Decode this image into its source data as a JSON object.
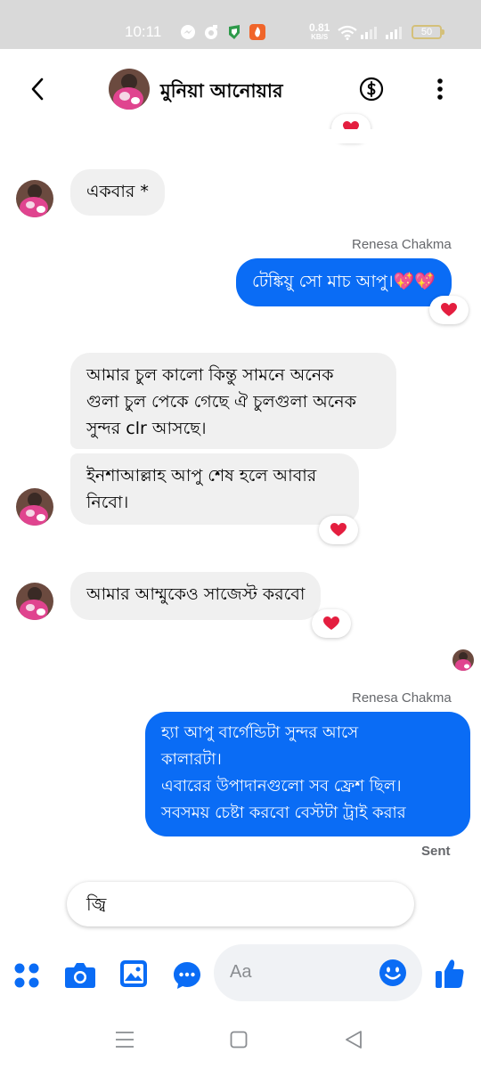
{
  "status_bar": {
    "time": "10:11",
    "net_speed_value": "0.81",
    "net_speed_unit": "KB/S",
    "battery": "50",
    "icons": [
      "messenger-icon",
      "camera-app-icon",
      "shield-app-icon",
      "fire-app-icon",
      "wifi-icon",
      "signal-icon",
      "signal-icon-2",
      "battery-icon"
    ]
  },
  "header": {
    "contact_name": "মুনিয়া আনোয়ার",
    "icons": [
      "back-arrow-icon",
      "dollar-icon",
      "more-vertical-icon"
    ]
  },
  "messages": [
    {
      "direction": "in",
      "text": "একবার *"
    },
    {
      "direction": "out",
      "sender": "Renesa Chakma",
      "text": "টেঙ্কিয়ু সো মাচ আপু।💖💖",
      "reaction": "heart"
    },
    {
      "direction": "in",
      "lines": [
        "আমার চুল কালো কিন্তু সামনে অনেক",
        "গুলা চুল পেকে গেছে ঐ চুলগুলা অনেক",
        "সুন্দর clr আসছে।"
      ]
    },
    {
      "direction": "in",
      "lines": [
        "ইনশাআল্লাহ আপু শেষ হলে আবার",
        "নিবো।"
      ],
      "reaction": "heart"
    },
    {
      "direction": "in",
      "text": "আমার আম্মুকেও সাজেস্ট করবো",
      "reaction": "heart"
    },
    {
      "direction": "out",
      "sender": "Renesa Chakma",
      "lines": [
        "হ্যা আপু বার্গেন্ডিটা সুন্দর আসে",
        "কালারটা।",
        "এবারের উপাদানগুলো সব ফ্রেশ ছিল।",
        "সবসময় চেষ্টা করবো বেস্টটা ট্রাই করার"
      ]
    }
  ],
  "sent_status": "Sent",
  "quick_reply": "জ্বি",
  "composer": {
    "placeholder": "Aa",
    "icons": [
      "menu-grid-icon",
      "camera-icon",
      "gallery-icon",
      "chat-bubble-icon",
      "emoji-icon",
      "thumbs-up-icon"
    ]
  },
  "nav_bar": {
    "icons": [
      "recent-apps-icon",
      "home-icon",
      "back-nav-icon"
    ]
  },
  "colors": {
    "accent": "#0a6cf5",
    "incoming_bubble": "#f0f0f0",
    "reaction_heart": "#e41e3f",
    "status_bar": "#d9d9d9"
  }
}
